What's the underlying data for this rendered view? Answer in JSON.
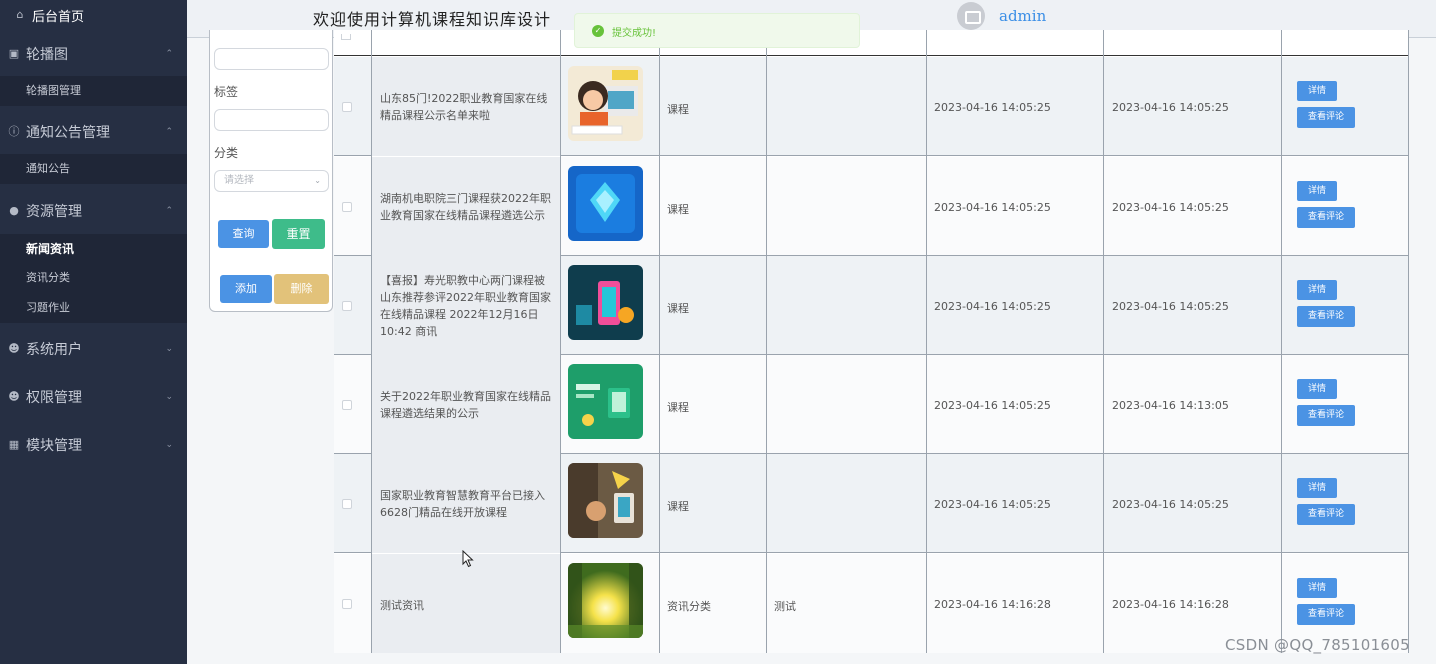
{
  "sidebar": {
    "home": "后台首页",
    "carousel": "轮播图",
    "carousel_manage": "轮播图管理",
    "notice": "通知公告管理",
    "notice_item": "通知公告",
    "resource": "资源管理",
    "news": "新闻资讯",
    "news_category": "资讯分类",
    "homework": "习题作业",
    "system_users": "系统用户",
    "permissions": "权限管理",
    "modules": "模块管理"
  },
  "header": {
    "title": "欢迎使用计算机课程知识库设计",
    "user": "admin"
  },
  "toast": {
    "message": "提交成功!"
  },
  "search": {
    "tag_label": "标签",
    "category_label": "分类",
    "category_placeholder": "请选择",
    "query": "查询",
    "reset": "重置",
    "add": "添加",
    "delete": "删除"
  },
  "table": {
    "rows": [
      {
        "title": "山东85门!2022职业教育国家在线精品课程公示名单来啦",
        "category": "课程",
        "tag": "",
        "created": "2023-04-16 14:05:25",
        "updated": "2023-04-16 14:05:25"
      },
      {
        "title": "湖南机电职院三门课程获2022年职业教育国家在线精品课程遴选公示",
        "category": "课程",
        "tag": "",
        "created": "2023-04-16 14:05:25",
        "updated": "2023-04-16 14:05:25"
      },
      {
        "title": "【喜报】寿光职教中心两门课程被山东推荐参评2022年职业教育国家在线精品课程 2022年12月16日 10:42 商讯",
        "category": "课程",
        "tag": "",
        "created": "2023-04-16 14:05:25",
        "updated": "2023-04-16 14:05:25"
      },
      {
        "title": "关于2022年职业教育国家在线精品课程遴选结果的公示",
        "category": "课程",
        "tag": "",
        "created": "2023-04-16 14:05:25",
        "updated": "2023-04-16 14:13:05"
      },
      {
        "title": "国家职业教育智慧教育平台已接入6628门精品在线开放课程",
        "category": "课程",
        "tag": "",
        "created": "2023-04-16 14:05:25",
        "updated": "2023-04-16 14:05:25"
      },
      {
        "title": "测试资讯",
        "category": "资讯分类",
        "tag": "测试",
        "created": "2023-04-16 14:16:28",
        "updated": "2023-04-16 14:16:28"
      }
    ],
    "detail_label": "详情",
    "review_label": "查看评论"
  },
  "watermark": "CSDN @QQ_785101605",
  "colors": {
    "sidebar_bg": "#262f43",
    "primary": "#4b93e4",
    "success": "#67c23a",
    "reset_green": "#3ebc8a",
    "delete_gold": "#e2c27a"
  }
}
